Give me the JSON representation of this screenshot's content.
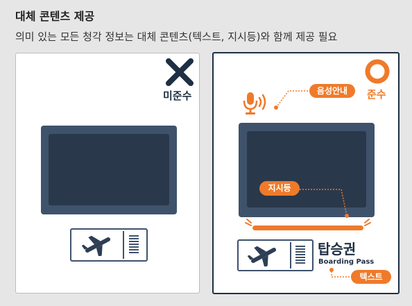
{
  "header": {
    "title": "대체 콘텐츠 제공",
    "subtitle": "의미 있는 모든 청각 정보는 대체 콘텐츠(텍스트, 지시등)와 함께 제공 필요"
  },
  "bad_example": {
    "verdict_label": "미준수",
    "verdict_icon": "x-mark-icon"
  },
  "good_example": {
    "verdict_label": "준수",
    "verdict_icon": "circle-o-icon",
    "voice_guide_label": "음성안내",
    "indicator_label": "지시등",
    "text_label": "텍스트",
    "boarding_pass_title": "탑승권",
    "boarding_pass_subtitle": "Boarding Pass"
  },
  "colors": {
    "accent": "#ef7a2a",
    "navy": "#1f2f44",
    "screen_frame": "#3f526b",
    "screen_inner": "#2a384b",
    "background": "#e6e6e6"
  }
}
